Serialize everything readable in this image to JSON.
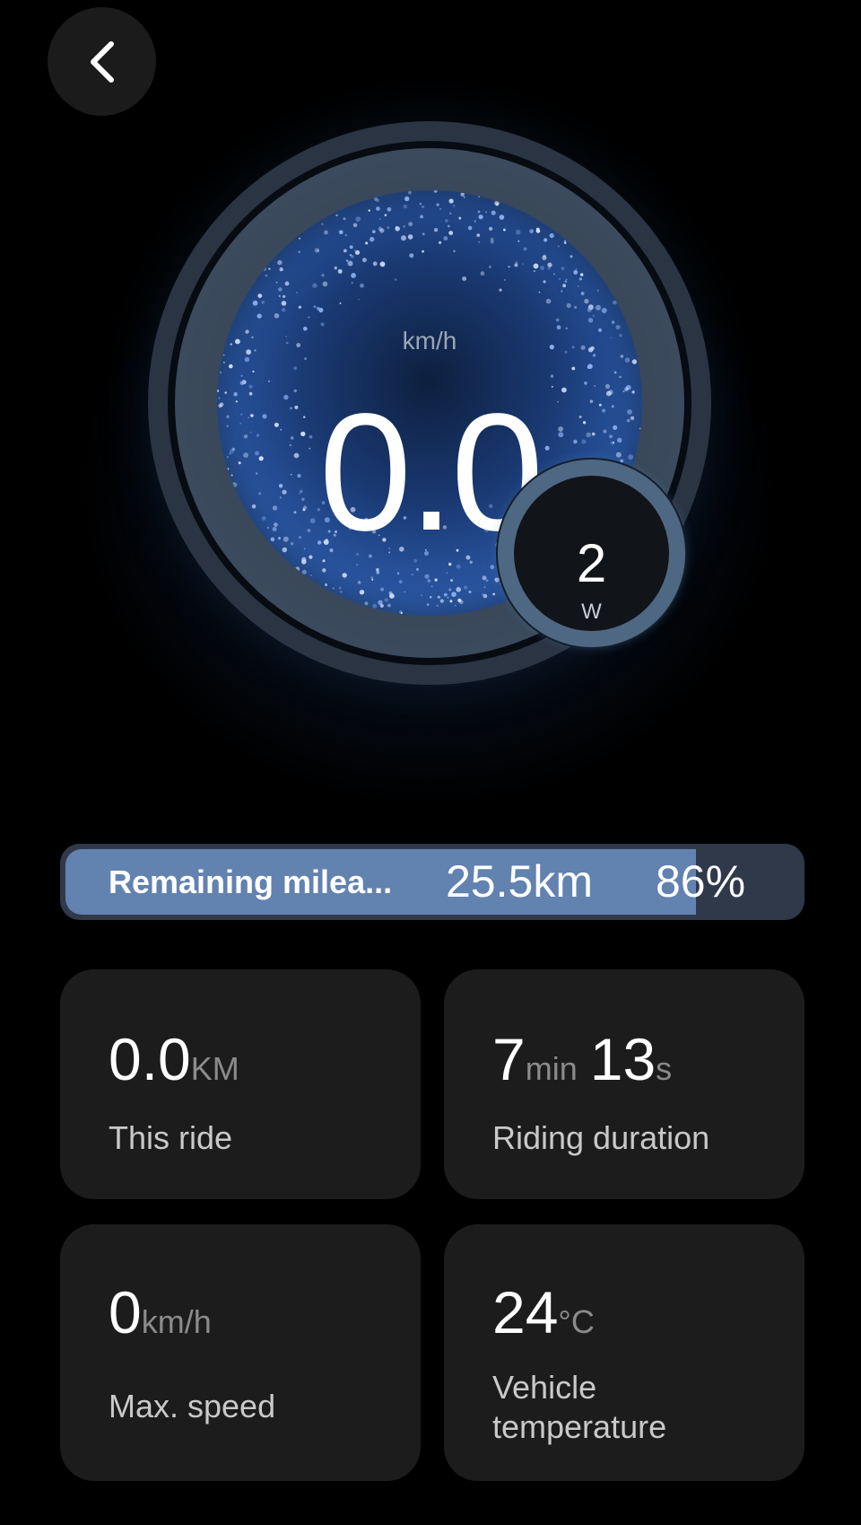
{
  "header": {
    "back_icon": "chevron-left-icon"
  },
  "gauge": {
    "speed_unit": "km/h",
    "speed_value": "0.0",
    "power_value": "2",
    "power_unit": "W"
  },
  "mileage": {
    "label": "Remaining milea...",
    "distance": "25.5km",
    "battery_percent": "86%",
    "battery_fraction": 0.86
  },
  "stats": {
    "this_ride": {
      "value": "0.0",
      "unit": "KM",
      "label": "This ride"
    },
    "riding_duration": {
      "minutes": "7",
      "min_unit": "min",
      "seconds": "13",
      "sec_unit": "s",
      "label": "Riding duration"
    },
    "max_speed": {
      "value": "0",
      "unit": "km/h",
      "label": "Max. speed"
    },
    "vehicle_temperature": {
      "value": "24",
      "unit": "°C",
      "label_line1": "Vehicle",
      "label_line2": "temperature"
    }
  },
  "colors": {
    "background": "#000000",
    "card": "#1c1c1c",
    "mileage_fill": "#6282b0",
    "mileage_track": "#30394a",
    "gauge_ring": "#3b4a5c",
    "gauge_face": "#2c5aa8"
  }
}
